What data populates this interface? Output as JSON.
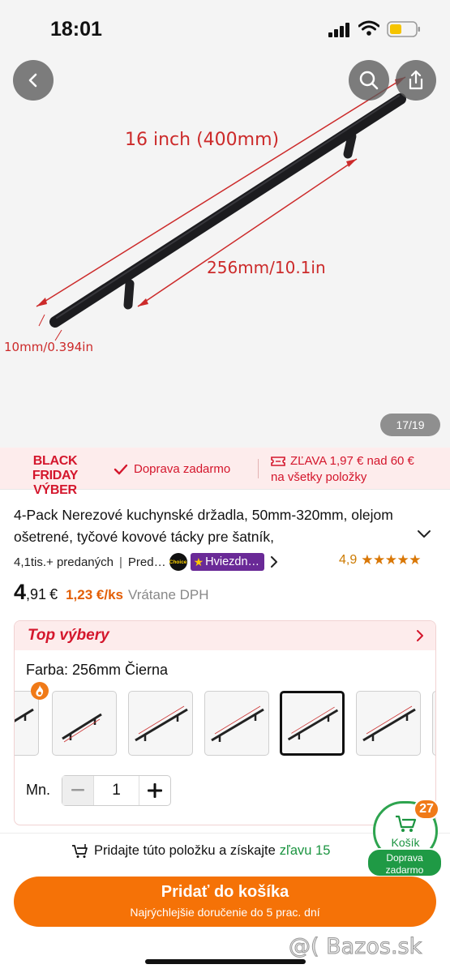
{
  "status_bar": {
    "time": "18:01"
  },
  "hero": {
    "dimension_labels": {
      "length": "16 inch (400mm)",
      "hole_spacing": "256mm/10.1in",
      "diameter": "10mm/0.394in"
    },
    "page_counter": "17/19"
  },
  "promo_strip": {
    "title_line1": "BLACK FRIDAY",
    "title_line2": "VÝBER",
    "free_shipping": "Doprava zadarmo",
    "discount_line1": "ZĽAVA 1,97 € nad 60 €",
    "discount_line2": "na všetky položky"
  },
  "product": {
    "title": "4-Pack Nerezové kuchynské držadla, 50mm-320mm, olejom ošetrené, tyčové kovové tácky pre šatník,",
    "sold": "4,1tis.+ predaných",
    "store_short": "Pred…",
    "choice_badge": "Choice",
    "star_badge": "Hviezdn…",
    "rating": "4,9",
    "stars": "★★★★★",
    "price_main": "4",
    "price_cents": ",91",
    "currency": "€",
    "unit_price": "1,23 €/ks",
    "vat_note": "Vrátane DPH"
  },
  "top_picks": {
    "title": "Top výbery",
    "color_label": "Farba: 256mm Čierna",
    "quantity_label": "Mn.",
    "quantity_value": "1"
  },
  "cart": {
    "count": "27",
    "label": "Košík",
    "free_shipping_line1": "Doprava",
    "free_shipping_line2": "zadarmo"
  },
  "bottom": {
    "promo_text": "Pridajte túto položku a získajte",
    "promo_highlight": "zľavu 15",
    "add_button": "Pridať do košíka",
    "delivery_note": "Najrýchlejšie doručenie do 5 prac. dní"
  },
  "watermark": "@( Bazos.sk",
  "colors": {
    "accent_orange": "#f57207",
    "promo_red": "#d4162c",
    "green": "#1f9a45"
  }
}
